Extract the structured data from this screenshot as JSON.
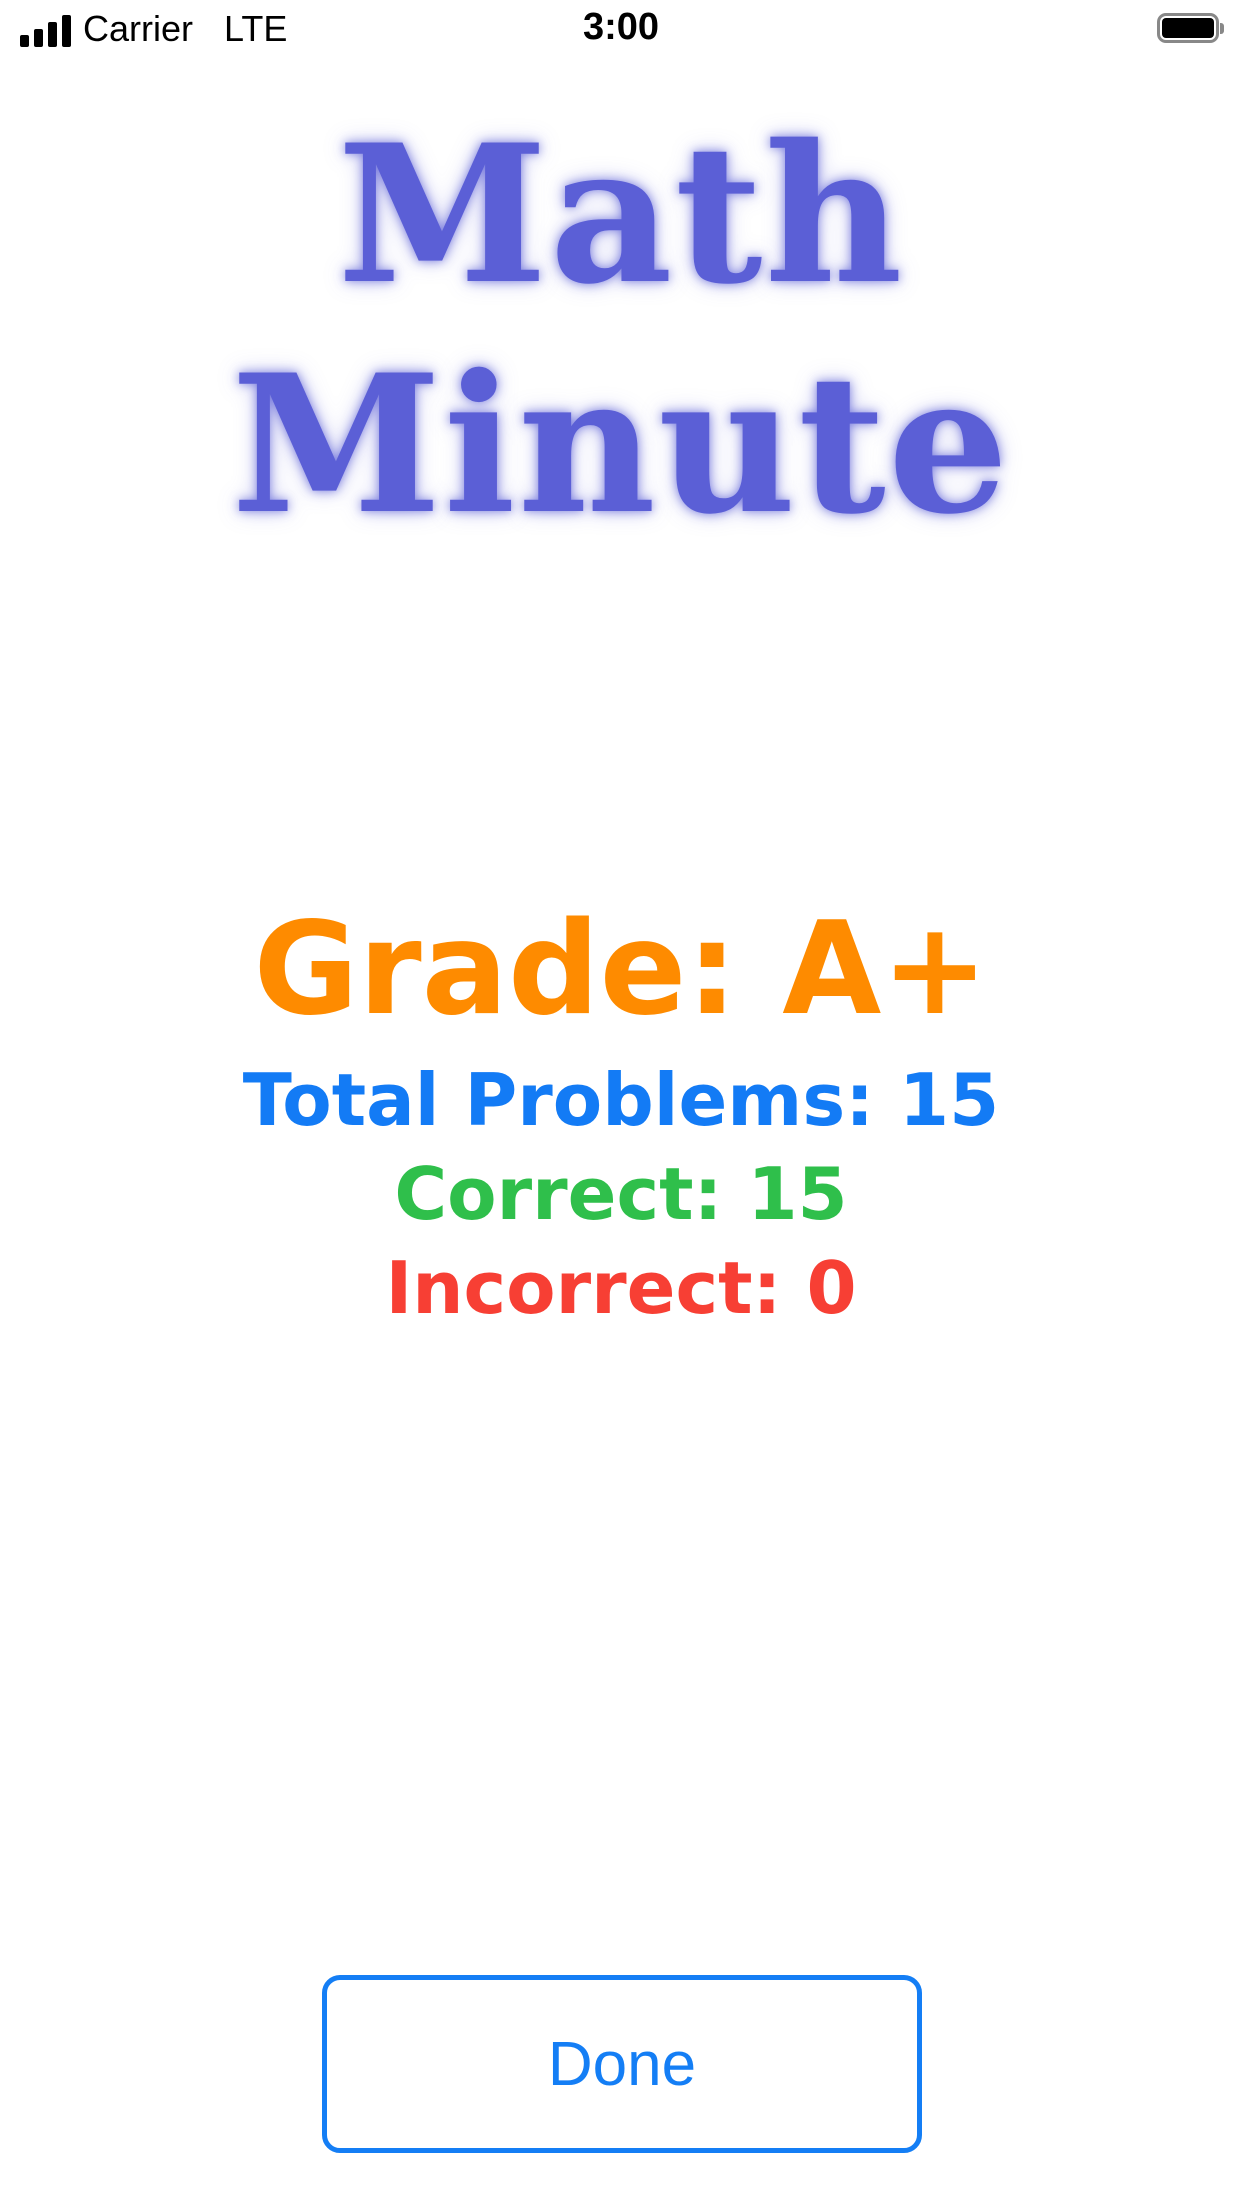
{
  "status_bar": {
    "carrier": "Carrier",
    "network": "LTE",
    "time": "3:00",
    "signal_icon": "signal-bars-icon",
    "battery_icon": "battery-full-icon"
  },
  "app": {
    "title": "Math Minute",
    "title_color": "#5b5fd6"
  },
  "results": {
    "grade": "Grade: A+",
    "total_problems": "Total Problems: 15",
    "correct": "Correct: 15",
    "incorrect": "Incorrect: 0",
    "colors": {
      "grade": "#fe8b00",
      "total": "#137bf5",
      "correct": "#2fbf4b",
      "incorrect": "#f73f34"
    }
  },
  "actions": {
    "done_label": "Done",
    "accent": "#147ef5"
  }
}
